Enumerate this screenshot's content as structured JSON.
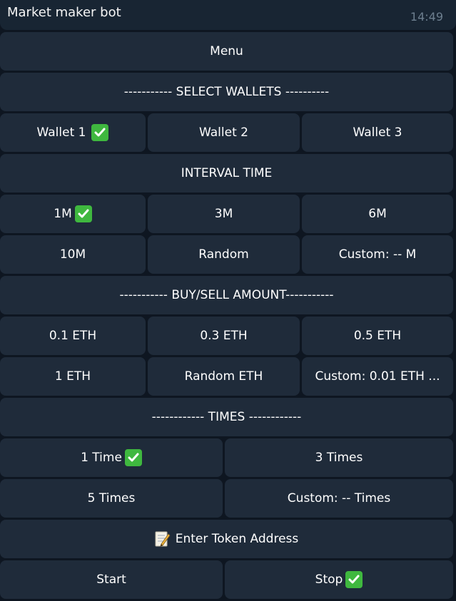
{
  "header": {
    "title": "Market maker bot",
    "time": "14:49"
  },
  "colors": {
    "background": "#0e1621",
    "button": "#1f2b3a",
    "check": "#3fb83f"
  },
  "buttons": {
    "menu": "Menu",
    "select_wallets": "----------- SELECT WALLETS ----------",
    "wallet_1": "Wallet 1",
    "wallet_2": "Wallet 2",
    "wallet_3": "Wallet 3",
    "interval_time": "INTERVAL TIME",
    "i_1m": "1M",
    "i_3m": "3M",
    "i_6m": "6M",
    "i_10m": "10M",
    "i_random": "Random",
    "i_custom": "Custom: -- M",
    "buy_sell_amount": "----------- BUY/SELL AMOUNT-----------",
    "a_01": "0.1 ETH",
    "a_03": "0.3 ETH",
    "a_05": "0.5 ETH",
    "a_1": "1 ETH",
    "a_random": "Random ETH",
    "a_custom": "Custom: 0.01 ETH ...",
    "times": "------------ TIMES ------------",
    "t_1": "1 Time",
    "t_3": "3 Times",
    "t_5": "5 Times",
    "t_custom": "Custom: -- Times",
    "enter_token": "Enter Token Address",
    "start": "Start",
    "stop": "Stop"
  },
  "icons": {
    "check": "check-mark-icon",
    "memo": "memo-icon"
  }
}
